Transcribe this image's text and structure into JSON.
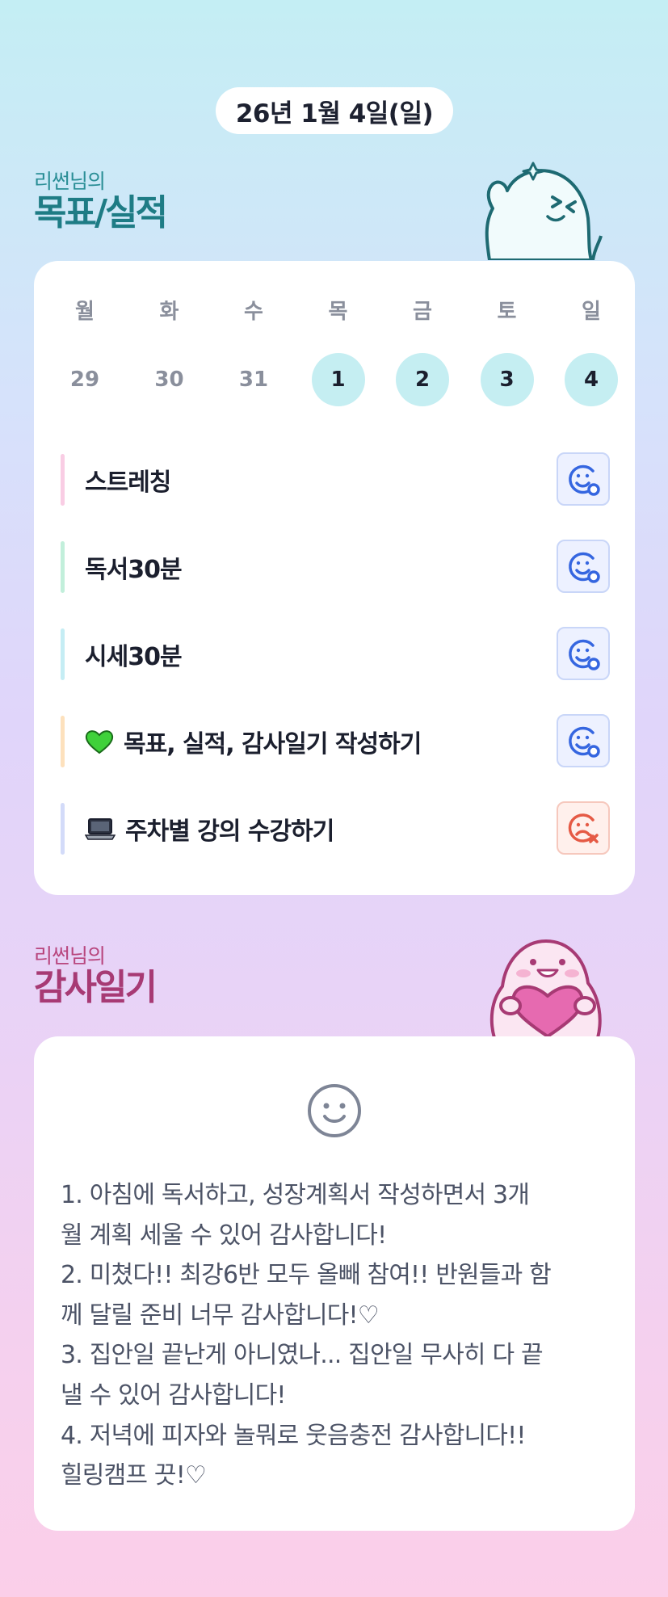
{
  "date_label": "26년 1월 4일(일)",
  "goals_section": {
    "owner": "리썬님의",
    "title": "목표/실적"
  },
  "week": {
    "weekdays": [
      "월",
      "화",
      "수",
      "목",
      "금",
      "토",
      "일"
    ],
    "dates": [
      {
        "label": "29",
        "active": false
      },
      {
        "label": "30",
        "active": false
      },
      {
        "label": "31",
        "active": false
      },
      {
        "label": "1",
        "active": true
      },
      {
        "label": "2",
        "active": true
      },
      {
        "label": "3",
        "active": true
      },
      {
        "label": "4",
        "active": true
      }
    ]
  },
  "tasks": [
    {
      "label": "스트레칭",
      "emoji": "",
      "bar_color": "#f9cde4",
      "status": "done"
    },
    {
      "label": "독서30분",
      "emoji": "",
      "bar_color": "#c2efdb",
      "status": "done"
    },
    {
      "label": "시세30분",
      "emoji": "",
      "bar_color": "#c5edf4",
      "status": "done"
    },
    {
      "label": "목표, 실적, 감사일기 작성하기",
      "emoji": "green-heart-icon",
      "bar_color": "#fde1bd",
      "status": "done"
    },
    {
      "label": "주차별 강의 수강하기",
      "emoji": "laptop-icon",
      "bar_color": "#d3dbf9",
      "status": "fail"
    }
  ],
  "gratitude_section": {
    "owner": "리썬님의",
    "title": "감사일기"
  },
  "gratitude": {
    "mood_icon": "smile-face-icon",
    "lines": [
      "1. 아침에 독서하고, 성장계획서 작성하면서 3개",
      "월 계획 세울 수 있어 감사합니다!",
      "2. 미쳤다!! 최강6반 모두 올빼 참여!! 반원들과 함",
      "께 달릴 준비 너무 감사합니다!♡",
      "3. 집안일 끝난게 아니였나... 집안일 무사히 다 끝",
      "낼 수 있어 감사합니다!",
      "4. 저녁에 피자와 놀뭐로 웃음충전 감사합니다!!",
      "힐링캠프 끗!♡"
    ]
  },
  "colors": {
    "accent_teal": "#1e7c85",
    "accent_pink": "#a73a74",
    "done_blue": "#3566e0",
    "fail_red": "#e55a45",
    "active_date_bg": "#c5eef2"
  }
}
